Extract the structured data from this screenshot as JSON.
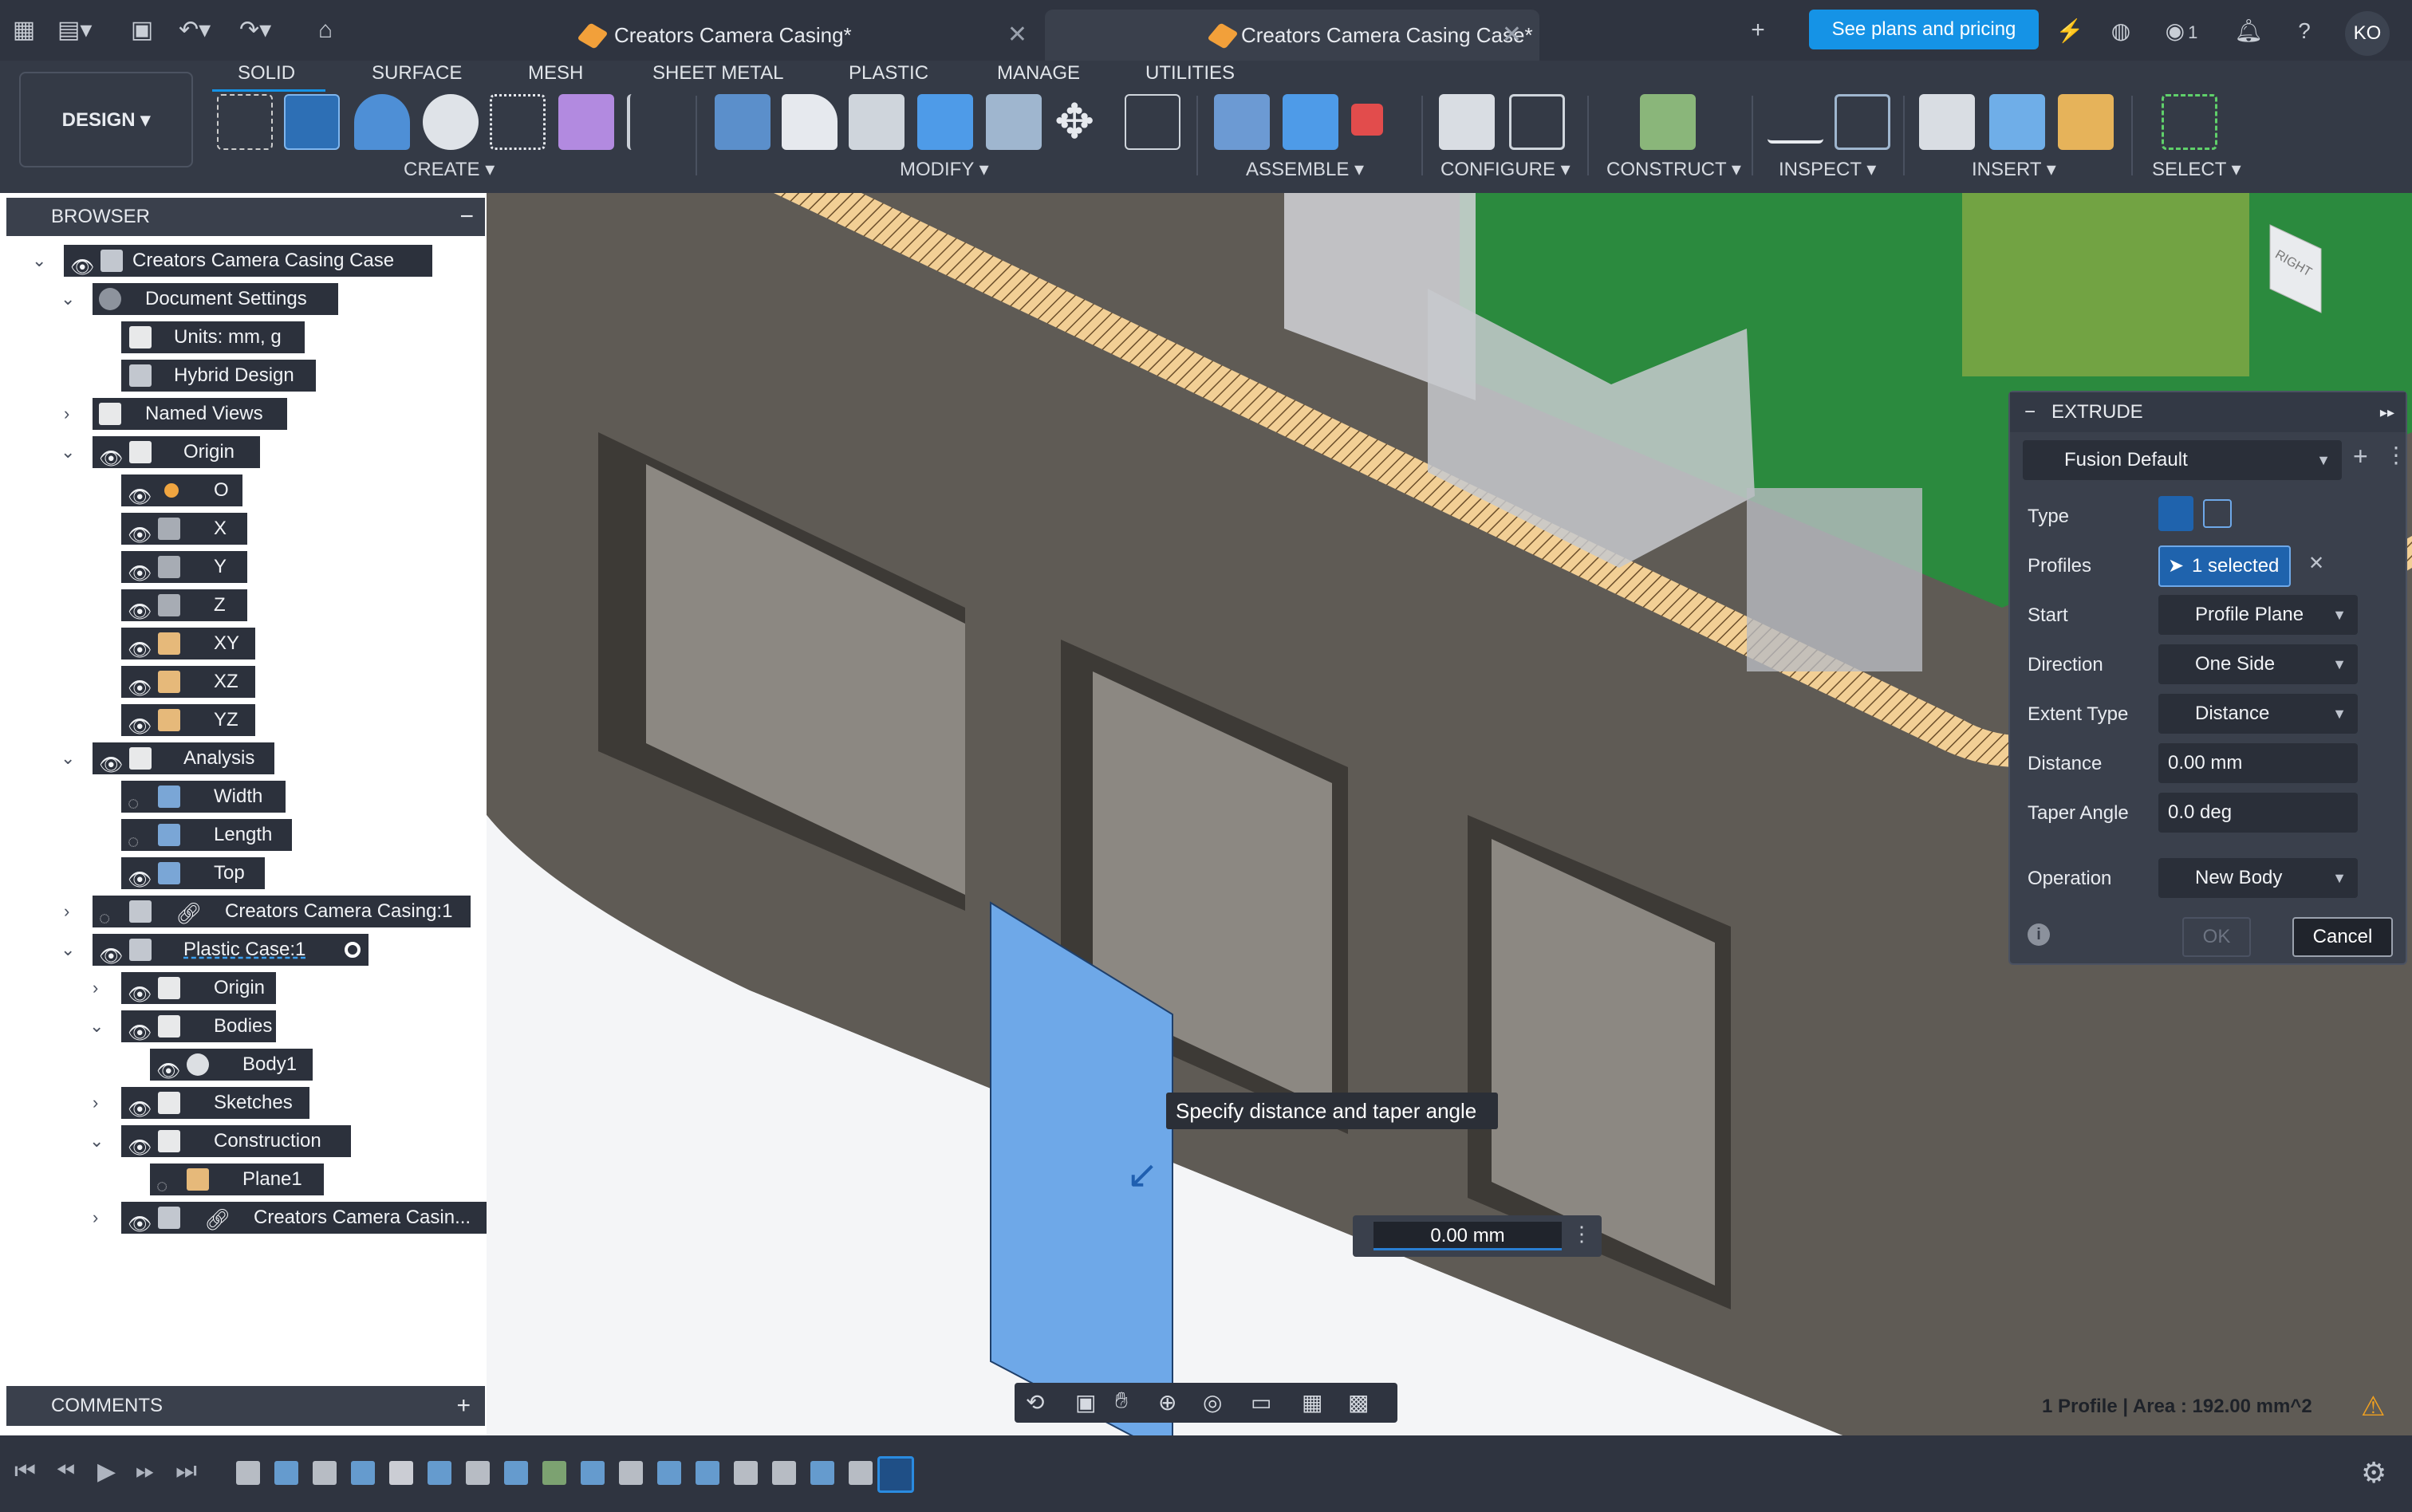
{
  "tabs": [
    {
      "label": "Creators Camera Casing*"
    },
    {
      "label": "Creators Camera Casing Case*"
    }
  ],
  "topbar": {
    "plans_button": "See plans and pricing",
    "notifications_count": "1",
    "avatar": "KO"
  },
  "toolbar": {
    "workspace": "DESIGN",
    "workspace_tabs": [
      "SOLID",
      "SURFACE",
      "MESH",
      "SHEET METAL",
      "PLASTIC",
      "MANAGE",
      "UTILITIES"
    ],
    "groups": [
      "CREATE",
      "MODIFY",
      "ASSEMBLE",
      "CONFIGURE",
      "CONSTRUCT",
      "INSPECT",
      "INSERT",
      "SELECT"
    ]
  },
  "browser": {
    "title": "BROWSER",
    "nodes": [
      {
        "label": "Creators Camera Casing Case"
      },
      {
        "label": "Document Settings"
      },
      {
        "label": "Units: mm, g"
      },
      {
        "label": "Hybrid Design"
      },
      {
        "label": "Named Views"
      },
      {
        "label": "Origin"
      },
      {
        "label": "O"
      },
      {
        "label": "X"
      },
      {
        "label": "Y"
      },
      {
        "label": "Z"
      },
      {
        "label": "XY"
      },
      {
        "label": "XZ"
      },
      {
        "label": "YZ"
      },
      {
        "label": "Analysis"
      },
      {
        "label": "Width"
      },
      {
        "label": "Length"
      },
      {
        "label": "Top"
      },
      {
        "label": "Creators Camera Casing:1"
      },
      {
        "label": "Plastic Case:1"
      },
      {
        "label": "Origin"
      },
      {
        "label": "Bodies"
      },
      {
        "label": "Body1"
      },
      {
        "label": "Sketches"
      },
      {
        "label": "Construction"
      },
      {
        "label": "Plane1"
      },
      {
        "label": "Creators Camera Casin..."
      }
    ]
  },
  "comments": {
    "title": "COMMENTS"
  },
  "extrude": {
    "title": "EXTRUDE",
    "preset": "Fusion Default",
    "rows": {
      "type": "Type",
      "profiles": "Profiles",
      "profiles_value": "1 selected",
      "start": "Start",
      "start_value": "Profile Plane",
      "direction": "Direction",
      "direction_value": "One Side",
      "extent_type": "Extent Type",
      "extent_type_value": "Distance",
      "distance": "Distance",
      "distance_value": "0.00 mm",
      "taper_angle": "Taper Angle",
      "taper_angle_value": "0.0 deg",
      "operation": "Operation",
      "operation_value": "New Body"
    },
    "ok": "OK",
    "cancel": "Cancel"
  },
  "viewport": {
    "tooltip": "Specify distance and taper angle",
    "distance_input": "0.00 mm",
    "status": "1 Profile | Area : 192.00 mm^2",
    "viewcube_face": "RIGHT"
  },
  "colors": {
    "accent": "#1593e6",
    "panel": "#3a404c",
    "profile_blue": "#6ea8e8",
    "case": "#5f5b55"
  }
}
